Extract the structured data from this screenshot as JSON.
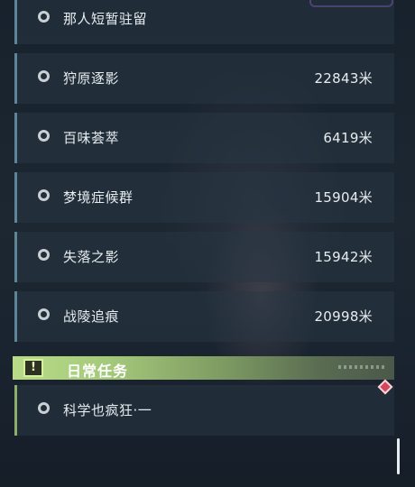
{
  "quests": [
    {
      "name": "那人短暂驻留",
      "distance": ""
    },
    {
      "name": "狩原逐影",
      "distance": "22843米"
    },
    {
      "name": "百味荟萃",
      "distance": "6419米"
    },
    {
      "name": "梦境症候群",
      "distance": "15904米"
    },
    {
      "name": "失落之影",
      "distance": "15942米"
    },
    {
      "name": "战陵追痕",
      "distance": "20998米"
    }
  ],
  "daily_section": {
    "title": "日常任务",
    "icon": "alert-icon",
    "quests": [
      {
        "name": "科学也疯狂·一"
      }
    ]
  },
  "colors": {
    "quest_accent": "#5d8597",
    "daily_accent": "#b8dc86",
    "alert": "#d3475c"
  }
}
